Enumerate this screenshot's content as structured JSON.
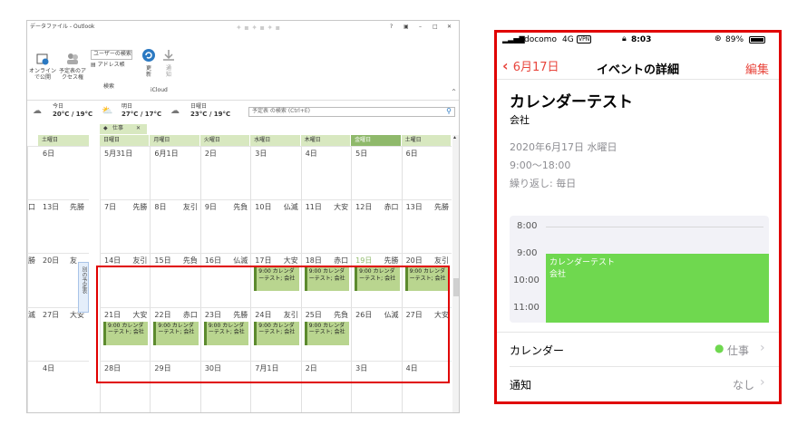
{
  "outlook": {
    "title": "データファイル - Outlook",
    "title_controls": [
      "?",
      "▣",
      "–",
      "□",
      "✕"
    ],
    "ribbon": {
      "online_publish": "オンラインで公開",
      "share_calendar": "予定表のアクセス権",
      "user_search": "ユーザーの検索",
      "address_book": "アドレス帳",
      "search_group": "検索",
      "update": "更新",
      "notify": "通知",
      "icloud_group": "iCloud"
    },
    "weather": [
      {
        "day": "今日",
        "temp": "20°C / 19°C"
      },
      {
        "day": "明日",
        "temp": "27°C / 17°C"
      },
      {
        "day": "日曜日",
        "temp": "23°C / 19°C"
      }
    ],
    "search_placeholder": "予定表 の検索 (Ctrl+E)",
    "calendar_tab": "仕事",
    "side_tab": "別の予定表",
    "left_header": "土曜日",
    "weekdays": [
      "日曜日",
      "月曜日",
      "火曜日",
      "水曜日",
      "木曜日",
      "金曜日",
      "土曜日"
    ],
    "left_rows": [
      {
        "prev": "",
        "date": "6日",
        "rokuyo": ""
      },
      {
        "prev": "口",
        "date": "13日",
        "rokuyo": "先勝"
      },
      {
        "prev": "勝",
        "date": "20日",
        "rokuyo": "友"
      },
      {
        "prev": "滅",
        "date": "27日",
        "rokuyo": "大安"
      },
      {
        "prev": "",
        "date": "4日",
        "rokuyo": ""
      }
    ],
    "rows": [
      [
        {
          "date": "5月31日",
          "rokuyo": ""
        },
        {
          "date": "6月1日",
          "rokuyo": ""
        },
        {
          "date": "2日",
          "rokuyo": ""
        },
        {
          "date": "3日",
          "rokuyo": ""
        },
        {
          "date": "4日",
          "rokuyo": ""
        },
        {
          "date": "5日",
          "rokuyo": ""
        },
        {
          "date": "6日",
          "rokuyo": ""
        }
      ],
      [
        {
          "date": "7日",
          "rokuyo": "先勝"
        },
        {
          "date": "8日",
          "rokuyo": "友引"
        },
        {
          "date": "9日",
          "rokuyo": "先負"
        },
        {
          "date": "10日",
          "rokuyo": "仏滅"
        },
        {
          "date": "11日",
          "rokuyo": "大安"
        },
        {
          "date": "12日",
          "rokuyo": "赤口"
        },
        {
          "date": "13日",
          "rokuyo": "先勝"
        }
      ],
      [
        {
          "date": "14日",
          "rokuyo": "友引"
        },
        {
          "date": "15日",
          "rokuyo": "先負"
        },
        {
          "date": "16日",
          "rokuyo": "仏滅"
        },
        {
          "date": "17日",
          "rokuyo": "大安",
          "event": "9:00 カレンダーテスト; 会社"
        },
        {
          "date": "18日",
          "rokuyo": "赤口",
          "event": "9:00 カレンダーテスト; 会社"
        },
        {
          "date": "19日",
          "rokuyo": "先勝",
          "event": "9:00 カレンダーテスト; 会社"
        },
        {
          "date": "20日",
          "rokuyo": "友引",
          "event": "9:00 カレンダーテスト; 会社"
        }
      ],
      [
        {
          "date": "21日",
          "rokuyo": "大安",
          "event": "9:00 カレンダーテスト; 会社"
        },
        {
          "date": "22日",
          "rokuyo": "赤口",
          "event": "9:00 カレンダーテスト; 会社"
        },
        {
          "date": "23日",
          "rokuyo": "先勝",
          "event": "9:00 カレンダーテスト; 会社"
        },
        {
          "date": "24日",
          "rokuyo": "友引",
          "event": "9:00 カレンダーテスト; 会社"
        },
        {
          "date": "25日",
          "rokuyo": "先負",
          "event": "9:00 カレンダーテスト; 会社"
        },
        {
          "date": "26日",
          "rokuyo": "仏滅"
        },
        {
          "date": "27日",
          "rokuyo": "大安"
        }
      ],
      [
        {
          "date": "28日",
          "rokuyo": ""
        },
        {
          "date": "29日",
          "rokuyo": ""
        },
        {
          "date": "30日",
          "rokuyo": ""
        },
        {
          "date": "7月1日",
          "rokuyo": ""
        },
        {
          "date": "2日",
          "rokuyo": ""
        },
        {
          "date": "3日",
          "rokuyo": ""
        },
        {
          "date": "4日",
          "rokuyo": ""
        }
      ]
    ],
    "accent_green": "#8fb96b",
    "highlight_red": "#e00000"
  },
  "phone": {
    "status": {
      "carrier": "docomo",
      "network": "4G",
      "vpn": "VPN",
      "time": "8:03",
      "battery": "89%"
    },
    "nav": {
      "back": "6月17日",
      "title": "イベントの詳細",
      "edit": "編集"
    },
    "event": {
      "title": "カレンダーテスト",
      "location": "会社",
      "date": "2020年6月17日 水曜日",
      "time": "9:00〜18:00",
      "repeat": "繰り返し: 毎日"
    },
    "timeline": {
      "hours": [
        "8:00",
        "9:00",
        "10:00",
        "11:00"
      ],
      "event_title": "カレンダーテスト",
      "event_location": "会社"
    },
    "rows": [
      {
        "label": "カレンダー",
        "value": "仕事"
      },
      {
        "label": "通知",
        "value": "なし"
      }
    ],
    "accent_red": "#e8453c",
    "event_green": "#6fd84f"
  }
}
